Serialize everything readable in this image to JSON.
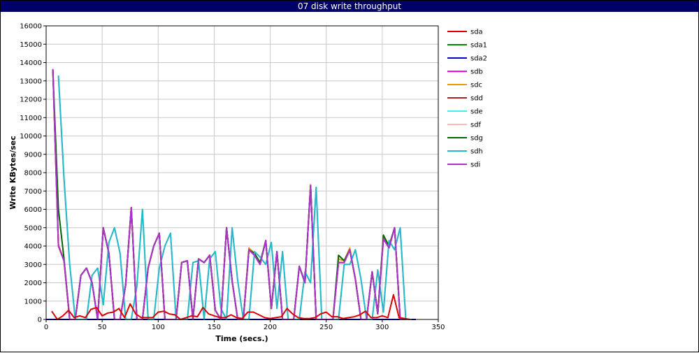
{
  "title": "07 disk write throughput",
  "chart_data": {
    "type": "line",
    "title": "07 disk write throughput",
    "xlabel": "Time (secs.)",
    "ylabel": "Write KBytes/sec",
    "xlim": [
      0,
      350
    ],
    "ylim": [
      0,
      16000
    ],
    "xticks": [
      0,
      50,
      100,
      150,
      200,
      250,
      300,
      350
    ],
    "yticks": [
      0,
      1000,
      2000,
      3000,
      4000,
      5000,
      6000,
      7000,
      8000,
      9000,
      10000,
      11000,
      12000,
      13000,
      14000,
      15000,
      16000
    ],
    "grid": true,
    "legend_position": "right",
    "series": [
      {
        "name": "sda",
        "color": "#dd0000",
        "x": [
          5,
          10,
          15,
          20,
          25,
          30,
          35,
          40,
          45,
          50,
          55,
          60,
          65,
          70,
          75,
          80,
          85,
          90,
          95,
          100,
          105,
          110,
          115,
          120,
          125,
          130,
          135,
          140,
          145,
          150,
          155,
          160,
          165,
          170,
          175,
          180,
          185,
          190,
          195,
          200,
          205,
          210,
          215,
          220,
          225,
          230,
          235,
          240,
          245,
          250,
          255,
          260,
          265,
          270,
          275,
          280,
          285,
          290,
          295,
          300,
          305,
          310,
          315,
          320,
          325
        ],
        "y": [
          450,
          0,
          200,
          500,
          100,
          200,
          100,
          550,
          650,
          200,
          350,
          400,
          600,
          100,
          850,
          300,
          100,
          100,
          100,
          400,
          450,
          300,
          250,
          0,
          100,
          200,
          150,
          650,
          300,
          200,
          100,
          100,
          250,
          100,
          50,
          400,
          400,
          250,
          100,
          50,
          100,
          150,
          600,
          300,
          100,
          50,
          50,
          100,
          300,
          400,
          150,
          150,
          50,
          100,
          150,
          250,
          450,
          100,
          100,
          200,
          100,
          1350,
          100,
          50,
          0
        ]
      },
      {
        "name": "sda1",
        "color": "#008800",
        "x": [
          0,
          330
        ],
        "y": [
          0,
          0
        ]
      },
      {
        "name": "sda2",
        "color": "#0000cc",
        "x": [
          0,
          330
        ],
        "y": [
          0,
          0
        ]
      },
      {
        "name": "sdb",
        "color": "#ff00ff",
        "x": [
          6,
          11,
          16,
          21,
          26,
          31,
          36,
          41,
          46,
          51,
          56,
          61,
          66,
          71,
          76,
          81,
          86,
          91,
          96,
          101,
          106,
          111,
          116,
          121,
          126,
          131,
          136,
          141,
          146,
          151,
          156,
          161,
          166,
          171,
          176,
          181,
          186,
          191,
          196,
          201,
          206,
          211,
          216,
          221,
          226,
          231,
          236,
          241,
          246,
          251,
          256,
          261,
          266,
          271,
          276,
          281,
          286,
          291,
          296,
          301,
          306,
          311,
          316,
          321
        ],
        "y": [
          13650,
          4000,
          3200,
          0,
          0,
          2400,
          2800,
          2000,
          0,
          5000,
          3600,
          0,
          0,
          1900,
          6100,
          0,
          0,
          2800,
          4000,
          4700,
          0,
          0,
          0,
          3100,
          3200,
          0,
          3300,
          3100,
          3500,
          500,
          0,
          5000,
          2100,
          0,
          0,
          3800,
          3500,
          3000,
          4300,
          600,
          3700,
          0,
          0,
          0,
          2900,
          2000,
          7300,
          0,
          0,
          0,
          0,
          3100,
          3100,
          3800,
          2200,
          0,
          0,
          2600,
          300,
          4400,
          3900,
          5000,
          0,
          0
        ]
      },
      {
        "name": "sdc",
        "color": "#ee9900",
        "x": [
          6,
          11,
          16,
          21,
          26,
          31,
          36,
          41,
          46,
          51,
          56,
          61,
          66,
          71,
          76,
          81,
          86,
          91,
          96,
          101,
          106,
          111,
          116,
          121,
          126,
          131,
          136,
          141,
          146,
          151,
          156,
          161,
          166,
          171,
          176,
          181,
          186,
          191,
          196,
          201,
          206,
          211,
          216,
          221,
          226,
          231,
          236,
          241,
          246,
          251,
          256,
          261,
          266,
          271,
          276,
          281,
          286,
          291,
          296,
          301,
          306,
          311,
          316,
          321
        ],
        "y": [
          13600,
          4100,
          3200,
          0,
          0,
          2400,
          2800,
          2000,
          0,
          5000,
          3600,
          0,
          0,
          1900,
          6100,
          0,
          0,
          2800,
          4000,
          4700,
          0,
          0,
          0,
          3100,
          3200,
          0,
          3300,
          3100,
          3500,
          500,
          0,
          5000,
          2100,
          0,
          0,
          3900,
          3600,
          3100,
          4300,
          600,
          3700,
          0,
          0,
          0,
          2900,
          2000,
          7350,
          0,
          0,
          0,
          0,
          3300,
          3200,
          3900,
          2200,
          0,
          0,
          2600,
          300,
          4500,
          4000,
          5000,
          0,
          0
        ]
      },
      {
        "name": "sdd",
        "color": "#aa2222",
        "x": [
          6,
          11,
          16,
          21,
          26,
          31,
          36,
          41,
          46,
          51,
          56,
          61,
          66,
          71,
          76,
          81,
          86,
          91,
          96,
          101,
          106,
          111,
          116,
          121,
          126,
          131,
          136,
          141,
          146,
          151,
          156,
          161,
          166,
          171,
          176,
          181,
          186,
          191,
          196,
          201,
          206,
          211,
          216,
          221,
          226,
          231,
          236,
          241,
          246,
          251,
          256,
          261,
          266,
          271,
          276,
          281,
          286,
          291,
          296,
          301,
          306,
          311,
          316,
          321
        ],
        "y": [
          13600,
          4000,
          3200,
          0,
          0,
          2400,
          2800,
          2000,
          0,
          5000,
          3600,
          0,
          0,
          1900,
          6100,
          0,
          0,
          2800,
          4000,
          4700,
          0,
          0,
          0,
          3100,
          3200,
          0,
          3300,
          3100,
          3500,
          500,
          0,
          5000,
          2100,
          0,
          0,
          3800,
          3500,
          3000,
          4300,
          600,
          3700,
          0,
          0,
          0,
          2900,
          2000,
          7300,
          0,
          0,
          0,
          0,
          3100,
          3100,
          3800,
          2200,
          0,
          0,
          2600,
          300,
          4400,
          3900,
          5000,
          0,
          0
        ]
      },
      {
        "name": "sde",
        "color": "#44eeee",
        "x": [
          11,
          16,
          21,
          26,
          31,
          36,
          41,
          46,
          51,
          56,
          61,
          66,
          71,
          76,
          81,
          86,
          91,
          96,
          101,
          106,
          111,
          116,
          121,
          126,
          131,
          136,
          141,
          146,
          151,
          156,
          161,
          166,
          171,
          176,
          181,
          186,
          191,
          196,
          201,
          206,
          211,
          216,
          221,
          226,
          231,
          236,
          241,
          246,
          251,
          256,
          261,
          266,
          271,
          276,
          281,
          286,
          291,
          296,
          301,
          306,
          311,
          316,
          321,
          326
        ],
        "y": [
          13200,
          7500,
          3000,
          0,
          0,
          0,
          2400,
          2800,
          800,
          4200,
          5000,
          3600,
          0,
          0,
          1800,
          6000,
          0,
          0,
          2800,
          4000,
          4700,
          0,
          0,
          0,
          3100,
          3200,
          0,
          3300,
          3700,
          600,
          0,
          5000,
          2100,
          0,
          0,
          3700,
          3400,
          3000,
          4200,
          600,
          3700,
          0,
          0,
          0,
          2600,
          2000,
          7200,
          0,
          0,
          0,
          0,
          3000,
          3000,
          3800,
          2200,
          0,
          0,
          2700,
          400,
          4300,
          3800,
          5000,
          0,
          0
        ]
      },
      {
        "name": "sdf",
        "color": "#ffbbbb",
        "x": [
          11,
          16,
          21,
          26,
          31,
          36,
          41,
          46,
          51,
          56,
          61,
          66,
          71,
          76,
          81,
          86,
          91,
          96,
          101,
          106,
          111,
          116,
          121,
          126,
          131,
          136,
          141,
          146,
          151,
          156,
          161,
          166,
          171,
          176,
          181,
          186,
          191,
          196,
          201,
          206,
          211,
          216,
          221,
          226,
          231,
          236,
          241,
          246,
          251,
          256,
          261,
          266,
          271,
          276,
          281,
          286,
          291,
          296,
          301,
          306,
          311,
          316,
          321,
          326
        ],
        "y": [
          13200,
          7500,
          3000,
          0,
          0,
          0,
          2400,
          2800,
          800,
          4200,
          5000,
          3600,
          0,
          0,
          1800,
          6000,
          0,
          0,
          2800,
          4000,
          4700,
          0,
          0,
          0,
          3100,
          3200,
          0,
          3300,
          3700,
          600,
          0,
          5000,
          2100,
          0,
          0,
          3700,
          3400,
          3000,
          4200,
          600,
          3700,
          0,
          0,
          0,
          2600,
          2000,
          7200,
          0,
          0,
          0,
          0,
          3000,
          3000,
          3800,
          2200,
          0,
          0,
          2700,
          400,
          4300,
          3800,
          5000,
          0,
          0
        ]
      },
      {
        "name": "sdg",
        "color": "#006600",
        "x": [
          6,
          11,
          16,
          21,
          26,
          31,
          36,
          41,
          46,
          51,
          56,
          61,
          66,
          71,
          76,
          81,
          86,
          91,
          96,
          101,
          106,
          111,
          116,
          121,
          126,
          131,
          136,
          141,
          146,
          151,
          156,
          161,
          166,
          171,
          176,
          181,
          186,
          191,
          196,
          201,
          206,
          211,
          216,
          221,
          226,
          231,
          236,
          241,
          246,
          251,
          256,
          261,
          266,
          271,
          276,
          281,
          286,
          291,
          296,
          301,
          306,
          311,
          316,
          321
        ],
        "y": [
          13600,
          6000,
          3300,
          0,
          0,
          2400,
          2800,
          2000,
          0,
          5000,
          3600,
          0,
          0,
          1900,
          6100,
          0,
          0,
          2800,
          4000,
          4700,
          0,
          0,
          0,
          3100,
          3200,
          0,
          3300,
          3100,
          3500,
          500,
          0,
          5000,
          2100,
          0,
          0,
          3800,
          3600,
          3100,
          4300,
          600,
          3700,
          0,
          0,
          0,
          2900,
          2000,
          7300,
          0,
          0,
          0,
          0,
          3500,
          3200,
          3800,
          2200,
          0,
          0,
          2600,
          300,
          4600,
          4000,
          5000,
          0,
          0
        ]
      },
      {
        "name": "sdh",
        "color": "#22bbcc",
        "x": [
          11,
          16,
          21,
          26,
          31,
          36,
          41,
          46,
          51,
          56,
          61,
          66,
          71,
          76,
          81,
          86,
          91,
          96,
          101,
          106,
          111,
          116,
          121,
          126,
          131,
          136,
          141,
          146,
          151,
          156,
          161,
          166,
          171,
          176,
          181,
          186,
          191,
          196,
          201,
          206,
          211,
          216,
          221,
          226,
          231,
          236,
          241,
          246,
          251,
          256,
          261,
          266,
          271,
          276,
          281,
          286,
          291,
          296,
          301,
          306,
          311,
          316,
          321,
          326
        ],
        "y": [
          13300,
          7700,
          3000,
          0,
          0,
          0,
          2400,
          2800,
          800,
          4200,
          5000,
          3600,
          0,
          0,
          1800,
          6000,
          0,
          0,
          2800,
          4000,
          4700,
          0,
          0,
          0,
          3100,
          3200,
          0,
          3300,
          3700,
          600,
          0,
          5000,
          2100,
          0,
          0,
          3700,
          3400,
          3000,
          4200,
          600,
          3700,
          0,
          0,
          0,
          2600,
          2000,
          7200,
          0,
          0,
          0,
          0,
          3000,
          3000,
          3800,
          2200,
          0,
          0,
          2700,
          400,
          4300,
          3800,
          5000,
          0,
          0
        ]
      },
      {
        "name": "sdi",
        "color": "#aa33cc",
        "x": [
          6,
          11,
          16,
          21,
          26,
          31,
          36,
          41,
          46,
          51,
          56,
          61,
          66,
          71,
          76,
          81,
          86,
          91,
          96,
          101,
          106,
          111,
          116,
          121,
          126,
          131,
          136,
          141,
          146,
          151,
          156,
          161,
          166,
          171,
          176,
          181,
          186,
          191,
          196,
          201,
          206,
          211,
          216,
          221,
          226,
          231,
          236,
          241,
          246,
          251,
          256,
          261,
          266,
          271,
          276,
          281,
          286,
          291,
          296,
          301,
          306,
          311,
          316,
          321
        ],
        "y": [
          13600,
          4000,
          3200,
          0,
          0,
          2400,
          2800,
          2000,
          0,
          5000,
          3600,
          0,
          0,
          1900,
          6100,
          0,
          0,
          2800,
          4000,
          4700,
          0,
          0,
          0,
          3100,
          3200,
          0,
          3300,
          3100,
          3500,
          500,
          0,
          5000,
          2100,
          0,
          0,
          3800,
          3500,
          3000,
          4300,
          600,
          3700,
          0,
          0,
          0,
          2900,
          2000,
          7300,
          0,
          0,
          0,
          0,
          3100,
          3100,
          3800,
          2200,
          0,
          0,
          2600,
          300,
          4400,
          3900,
          5000,
          0,
          0
        ]
      }
    ]
  }
}
